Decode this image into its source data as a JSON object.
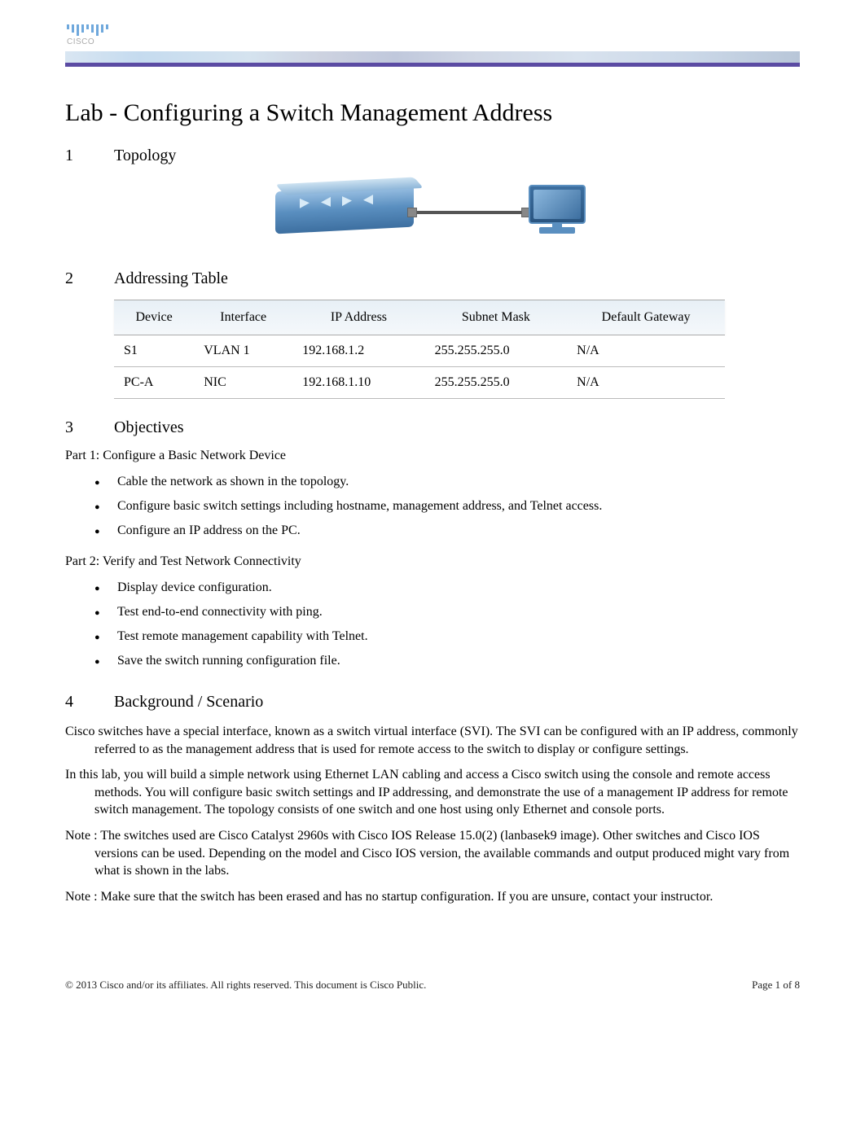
{
  "header": {
    "logo_text": "CISCO"
  },
  "title": "Lab - Configuring a Switch Management Address",
  "sections": {
    "s1": {
      "num": "1",
      "label": "Topology"
    },
    "s2": {
      "num": "2",
      "label": "Addressing Table"
    },
    "s3": {
      "num": "3",
      "label": "Objectives"
    },
    "s4": {
      "num": "4",
      "label": "Background / Scenario"
    }
  },
  "addressing": {
    "headers": {
      "device": "Device",
      "interface": "Interface",
      "ip": "IP Address",
      "mask": "Subnet Mask",
      "gateway": "Default Gateway"
    },
    "rows": [
      {
        "device": "S1",
        "interface": "VLAN 1",
        "ip": "192.168.1.2",
        "mask": "255.255.255.0",
        "gateway": "N/A"
      },
      {
        "device": "PC-A",
        "interface": "NIC",
        "ip": "192.168.1.10",
        "mask": "255.255.255.0",
        "gateway": "N/A"
      }
    ]
  },
  "objectives": {
    "part1_label": "Part 1: Configure a Basic Network Device",
    "part1_items": [
      "Cable the network as shown in the topology.",
      "Configure basic switch settings including hostname, management address, and Telnet access.",
      "Configure an IP address on the PC."
    ],
    "part2_label": "Part 2: Verify and Test Network Connectivity",
    "part2_items": [
      "Display device configuration.",
      "Test end-to-end connectivity with ping.",
      "Test remote management capability with Telnet.",
      "Save the switch running configuration file."
    ]
  },
  "background": {
    "p1": "Cisco switches have a special interface, known as a switch virtual interface (SVI). The SVI can be configured with an IP address, commonly referred to as the management address that is used for remote access to the switch to display or configure settings.",
    "p2": "In this lab, you will build a simple network using Ethernet LAN cabling and access a Cisco switch using the console and remote access methods. You will configure basic switch settings and IP addressing, and demonstrate the use of a management IP address for remote switch management. The topology consists of one switch and one host using only Ethernet and console ports.",
    "p3": "Note : The switches used are Cisco Catalyst 2960s with Cisco IOS Release 15.0(2) (lanbasek9 image). Other switches and Cisco IOS versions can be used. Depending on the model and Cisco IOS version, the available commands and output produced might vary from what is shown in the labs.",
    "p4": "Note : Make sure that the switch has been erased and has no startup configuration. If you are unsure, contact your instructor."
  },
  "footer": {
    "copyright": "© 2013 Cisco and/or its affiliates. All rights reserved. This document is Cisco Public.",
    "page": "Page  1  of 8"
  }
}
